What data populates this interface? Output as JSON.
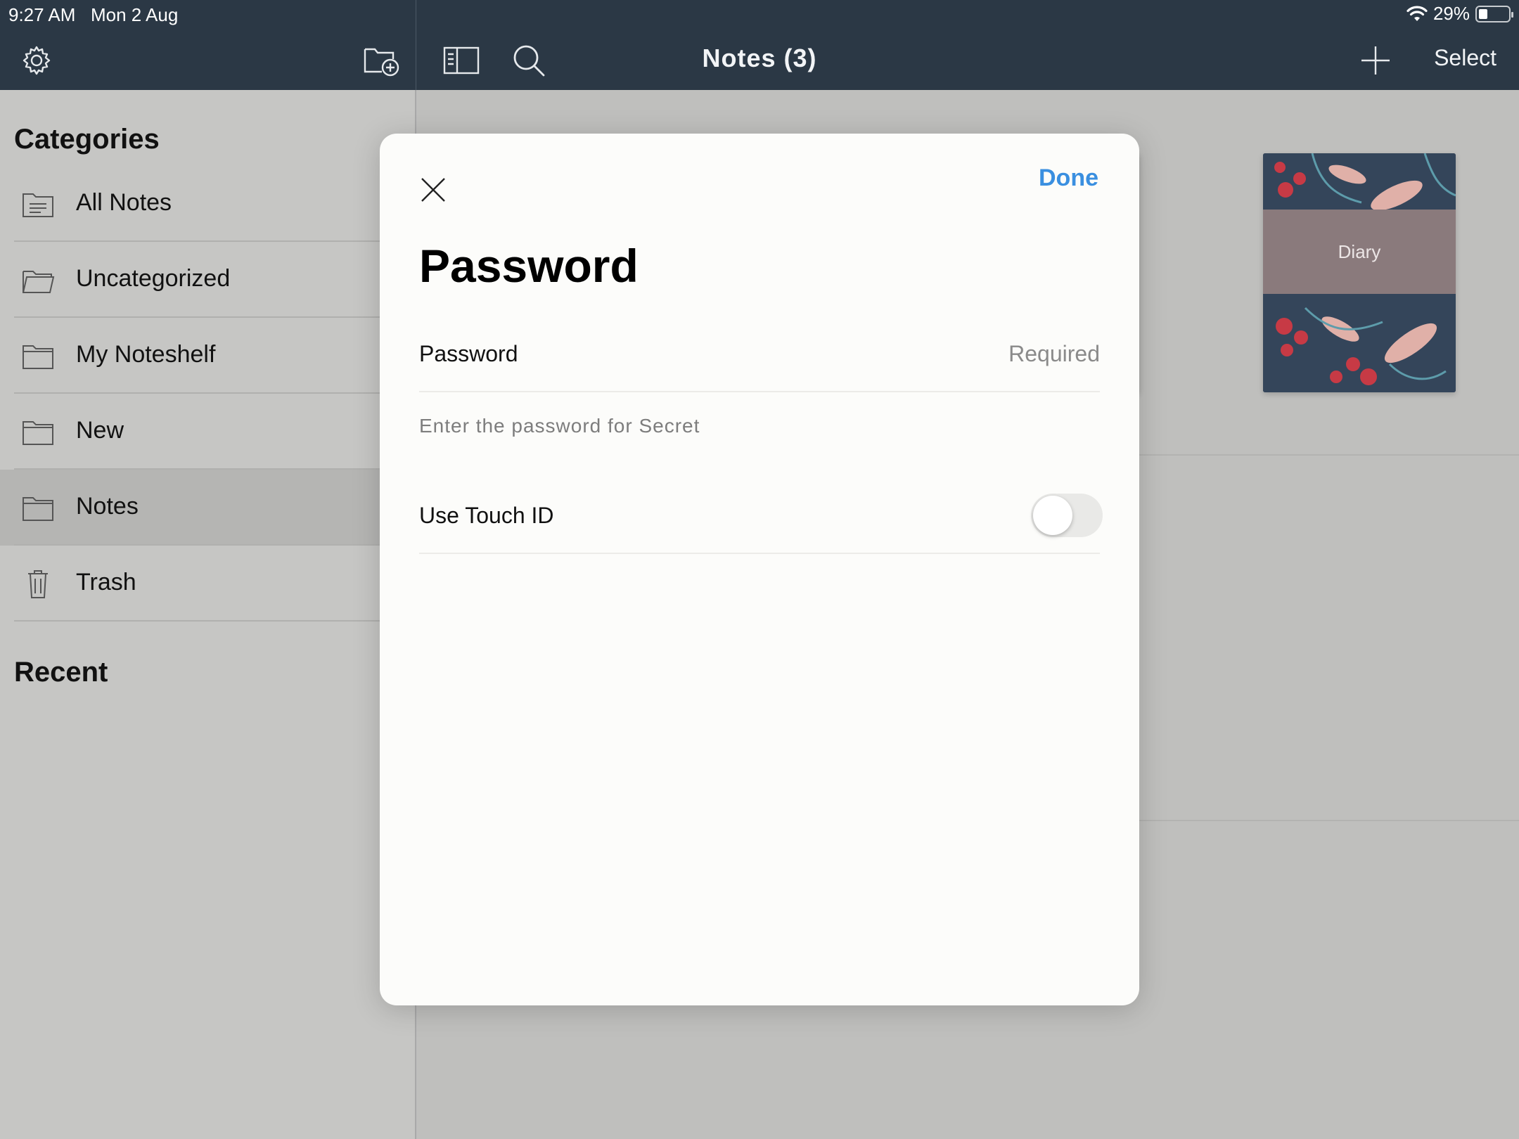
{
  "status_bar": {
    "time": "9:27 AM",
    "date": "Mon 2 Aug",
    "battery": "29%",
    "icons": [
      "wifi-icon",
      "battery-icon"
    ]
  },
  "nav": {
    "title": "Notes (3)",
    "select_label": "Select",
    "icons": [
      "gear-icon",
      "add-folder-icon",
      "sidebar-toggle-icon",
      "search-icon",
      "plus-icon"
    ]
  },
  "sidebar": {
    "categories_title": "Categories",
    "recent_title": "Recent",
    "items": [
      {
        "label": "All Notes",
        "icon": "all-notes-icon"
      },
      {
        "label": "Uncategorized",
        "icon": "open-folder-icon"
      },
      {
        "label": "My Noteshelf",
        "icon": "folder-icon"
      },
      {
        "label": "New",
        "icon": "folder-icon"
      },
      {
        "label": "Notes",
        "icon": "folder-icon",
        "selected": true
      },
      {
        "label": "Trash",
        "icon": "trash-icon"
      }
    ]
  },
  "notebooks": [
    {
      "title": ""
    },
    {
      "title": "Diary"
    }
  ],
  "modal": {
    "title": "Password",
    "done_label": "Done",
    "password_label": "Password",
    "password_placeholder": "Required",
    "hint": "Enter the password for Secret",
    "touch_id_label": "Use Touch ID",
    "touch_id_enabled": false,
    "colors": {
      "accent": "#3a8fe0"
    }
  }
}
